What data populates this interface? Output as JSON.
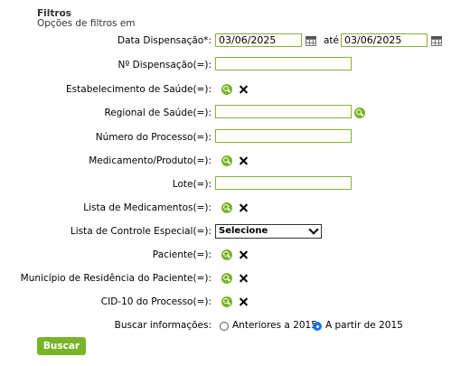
{
  "header": {
    "title": "Filtros",
    "subtitle": "Opções de filtros em"
  },
  "fields": {
    "data_dispensacao": {
      "label": "Data Dispensação*:",
      "from_value": "03/06/2025",
      "connector": "até",
      "to_value": "03/06/2025"
    },
    "n_dispensacao": {
      "label": "Nº Dispensação(=):",
      "value": ""
    },
    "estabelecimento": {
      "label": "Estabelecimento de Saúde(=):"
    },
    "regional": {
      "label": "Regional de Saúde(=):",
      "value": ""
    },
    "numero_processo": {
      "label": "Número do Processo(=):",
      "value": ""
    },
    "medicamento": {
      "label": "Medicamento/Produto(=):"
    },
    "lote": {
      "label": "Lote(=):",
      "value": ""
    },
    "lista_medicamentos": {
      "label": "Lista de Medicamentos(=):"
    },
    "lista_controle": {
      "label": "Lista de Controle Especial(=):",
      "selected": "Selecione"
    },
    "paciente": {
      "label": "Paciente(=):"
    },
    "municipio": {
      "label": "Município de Residência do Paciente(=):"
    },
    "cid10": {
      "label": "CID-10 do Processo(=):"
    },
    "buscar": {
      "label": "Buscar informações:",
      "options": [
        {
          "label": "Anteriores a 2015",
          "checked": false
        },
        {
          "label": "A partir de 2015",
          "checked": true
        }
      ]
    }
  },
  "actions": {
    "search_label": "Buscar"
  },
  "colors": {
    "accent": "#78b428",
    "input_border": "#7fb23a"
  }
}
